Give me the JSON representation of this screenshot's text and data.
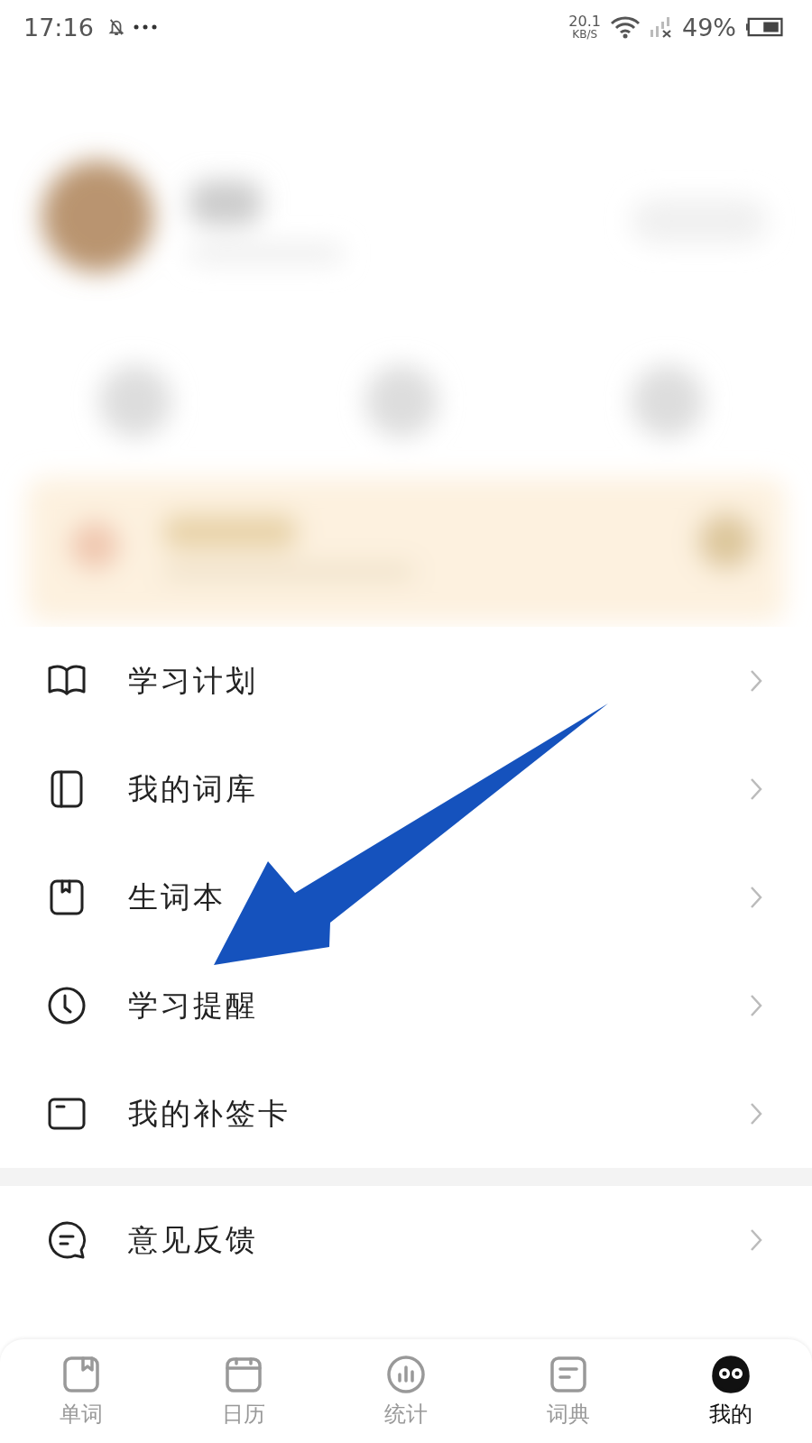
{
  "status_bar": {
    "time": "17:16",
    "speed_value": "20.1",
    "speed_unit": "KB/S",
    "battery": "49%"
  },
  "menu_groups": [
    {
      "items": [
        {
          "label": "学习计划",
          "kind": "book"
        },
        {
          "label": "我的词库",
          "kind": "library"
        },
        {
          "label": "生词本",
          "kind": "bookmark"
        },
        {
          "label": "学习提醒",
          "kind": "clock"
        },
        {
          "label": "我的补签卡",
          "kind": "card"
        }
      ]
    },
    {
      "items": [
        {
          "label": "意见反馈",
          "kind": "feedback"
        }
      ]
    }
  ],
  "bottom_nav": [
    {
      "label": "单词",
      "kind": "bookmark",
      "selected": false
    },
    {
      "label": "日历",
      "kind": "calendar",
      "selected": false
    },
    {
      "label": "统计",
      "kind": "chart",
      "selected": false
    },
    {
      "label": "词典",
      "kind": "dict",
      "selected": false
    },
    {
      "label": "我的",
      "kind": "owl",
      "selected": true
    }
  ]
}
